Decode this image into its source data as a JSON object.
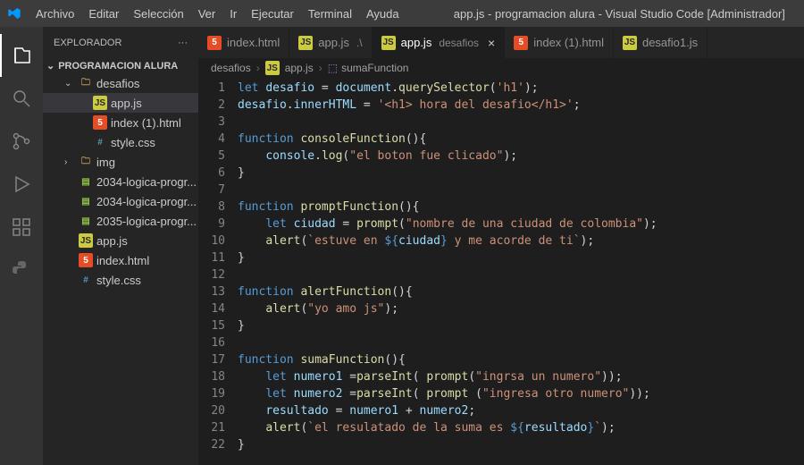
{
  "title": "app.js - programacion alura - Visual Studio Code [Administrador]",
  "menu": {
    "file": "Archivo",
    "edit": "Editar",
    "selection": "Selección",
    "view": "Ver",
    "go": "Ir",
    "run": "Ejecutar",
    "terminal": "Terminal",
    "help": "Ayuda"
  },
  "sidebar": {
    "title": "EXPLORADOR",
    "project": "PROGRAMACION ALURA",
    "tree": [
      {
        "label": "desafios",
        "type": "folder",
        "indent": 1,
        "expanded": true
      },
      {
        "label": "app.js",
        "type": "js",
        "indent": 2,
        "selected": true
      },
      {
        "label": "index (1).html",
        "type": "html",
        "indent": 2
      },
      {
        "label": "style.css",
        "type": "css",
        "indent": 2
      },
      {
        "label": "img",
        "type": "folder",
        "indent": 1,
        "expanded": false
      },
      {
        "label": "2034-logica-progr...",
        "type": "zip",
        "indent": 1
      },
      {
        "label": "2034-logica-progr...",
        "type": "zip",
        "indent": 1
      },
      {
        "label": "2035-logica-progr...",
        "type": "zip",
        "indent": 1
      },
      {
        "label": "app.js",
        "type": "js",
        "indent": 1
      },
      {
        "label": "index.html",
        "type": "html",
        "indent": 1
      },
      {
        "label": "style.css",
        "type": "css",
        "indent": 1
      }
    ]
  },
  "tabs": [
    {
      "label": "index.html",
      "icon": "html"
    },
    {
      "label": "app.js",
      "suffix": ".\\",
      "icon": "js"
    },
    {
      "label": "app.js",
      "suffix": "desafios",
      "icon": "js",
      "active": true,
      "closable": true
    },
    {
      "label": "index (1).html",
      "icon": "html"
    },
    {
      "label": "desafio1.js",
      "icon": "js"
    }
  ],
  "breadcrumbs": {
    "p0": "desafios",
    "p1": "app.js",
    "p2": "sumaFunction"
  },
  "code": {
    "lines": [
      [
        {
          "c": "kw",
          "t": "let"
        },
        {
          "c": "pun",
          "t": " "
        },
        {
          "c": "var",
          "t": "desafio"
        },
        {
          "c": "pun",
          "t": " = "
        },
        {
          "c": "obj",
          "t": "document"
        },
        {
          "c": "pun",
          "t": "."
        },
        {
          "c": "fn",
          "t": "querySelector"
        },
        {
          "c": "pun",
          "t": "("
        },
        {
          "c": "str",
          "t": "'h1'"
        },
        {
          "c": "pun",
          "t": ");"
        }
      ],
      [
        {
          "c": "obj",
          "t": "desafio"
        },
        {
          "c": "pun",
          "t": "."
        },
        {
          "c": "obj",
          "t": "innerHTML"
        },
        {
          "c": "pun",
          "t": " = "
        },
        {
          "c": "str",
          "t": "'<h1> hora del desafio</h1>'"
        },
        {
          "c": "pun",
          "t": ";"
        }
      ],
      [],
      [
        {
          "c": "kw",
          "t": "function"
        },
        {
          "c": "pun",
          "t": " "
        },
        {
          "c": "fn",
          "t": "consoleFunction"
        },
        {
          "c": "pun",
          "t": "(){"
        }
      ],
      [
        {
          "c": "pun",
          "t": "    "
        },
        {
          "c": "obj",
          "t": "console"
        },
        {
          "c": "pun",
          "t": "."
        },
        {
          "c": "fn",
          "t": "log"
        },
        {
          "c": "pun",
          "t": "("
        },
        {
          "c": "str",
          "t": "\"el boton fue clicado\""
        },
        {
          "c": "pun",
          "t": ");"
        }
      ],
      [
        {
          "c": "pun",
          "t": "}"
        }
      ],
      [],
      [
        {
          "c": "kw",
          "t": "function"
        },
        {
          "c": "pun",
          "t": " "
        },
        {
          "c": "fn",
          "t": "promptFunction"
        },
        {
          "c": "pun",
          "t": "(){"
        }
      ],
      [
        {
          "c": "pun",
          "t": "    "
        },
        {
          "c": "kw",
          "t": "let"
        },
        {
          "c": "pun",
          "t": " "
        },
        {
          "c": "var",
          "t": "ciudad"
        },
        {
          "c": "pun",
          "t": " = "
        },
        {
          "c": "fn",
          "t": "prompt"
        },
        {
          "c": "pun",
          "t": "("
        },
        {
          "c": "str",
          "t": "\"nombre de una ciudad de colombia\""
        },
        {
          "c": "pun",
          "t": ");"
        }
      ],
      [
        {
          "c": "pun",
          "t": "    "
        },
        {
          "c": "fn",
          "t": "alert"
        },
        {
          "c": "pun",
          "t": "("
        },
        {
          "c": "str",
          "t": "`estuve en "
        },
        {
          "c": "tmpl",
          "t": "${"
        },
        {
          "c": "var",
          "t": "ciudad"
        },
        {
          "c": "tmpl",
          "t": "}"
        },
        {
          "c": "str",
          "t": " y me acorde de ti`"
        },
        {
          "c": "pun",
          "t": ");"
        }
      ],
      [
        {
          "c": "pun",
          "t": "}"
        }
      ],
      [],
      [
        {
          "c": "kw",
          "t": "function"
        },
        {
          "c": "pun",
          "t": " "
        },
        {
          "c": "fn",
          "t": "alertFunction"
        },
        {
          "c": "pun",
          "t": "(){"
        }
      ],
      [
        {
          "c": "pun",
          "t": "    "
        },
        {
          "c": "fn",
          "t": "alert"
        },
        {
          "c": "pun",
          "t": "("
        },
        {
          "c": "str",
          "t": "\"yo amo js\""
        },
        {
          "c": "pun",
          "t": ");"
        }
      ],
      [
        {
          "c": "pun",
          "t": "}"
        }
      ],
      [],
      [
        {
          "c": "kw",
          "t": "function"
        },
        {
          "c": "pun",
          "t": " "
        },
        {
          "c": "fn",
          "t": "sumaFunction"
        },
        {
          "c": "pun",
          "t": "(){"
        }
      ],
      [
        {
          "c": "pun",
          "t": "    "
        },
        {
          "c": "kw",
          "t": "let"
        },
        {
          "c": "pun",
          "t": " "
        },
        {
          "c": "var",
          "t": "numero1"
        },
        {
          "c": "pun",
          "t": " ="
        },
        {
          "c": "fn",
          "t": "parseInt"
        },
        {
          "c": "pun",
          "t": "( "
        },
        {
          "c": "fn",
          "t": "prompt"
        },
        {
          "c": "pun",
          "t": "("
        },
        {
          "c": "str",
          "t": "\"ingrsa un numero\""
        },
        {
          "c": "pun",
          "t": "));"
        }
      ],
      [
        {
          "c": "pun",
          "t": "    "
        },
        {
          "c": "kw",
          "t": "let"
        },
        {
          "c": "pun",
          "t": " "
        },
        {
          "c": "var",
          "t": "numero2"
        },
        {
          "c": "pun",
          "t": " ="
        },
        {
          "c": "fn",
          "t": "parseInt"
        },
        {
          "c": "pun",
          "t": "( "
        },
        {
          "c": "fn",
          "t": "prompt"
        },
        {
          "c": "pun",
          "t": " ("
        },
        {
          "c": "str",
          "t": "\"ingresa otro numero\""
        },
        {
          "c": "pun",
          "t": "));"
        }
      ],
      [
        {
          "c": "pun",
          "t": "    "
        },
        {
          "c": "var",
          "t": "resultado"
        },
        {
          "c": "pun",
          "t": " = "
        },
        {
          "c": "var",
          "t": "numero1"
        },
        {
          "c": "pun",
          "t": " + "
        },
        {
          "c": "var",
          "t": "numero2"
        },
        {
          "c": "pun",
          "t": ";"
        }
      ],
      [
        {
          "c": "pun",
          "t": "    "
        },
        {
          "c": "fn",
          "t": "alert"
        },
        {
          "c": "pun",
          "t": "("
        },
        {
          "c": "str",
          "t": "`el resulatado de la suma es "
        },
        {
          "c": "tmpl",
          "t": "${"
        },
        {
          "c": "var",
          "t": "resultado"
        },
        {
          "c": "tmpl",
          "t": "}"
        },
        {
          "c": "str",
          "t": "`"
        },
        {
          "c": "pun",
          "t": ");"
        }
      ],
      [
        {
          "c": "pun",
          "t": "}"
        }
      ]
    ]
  }
}
